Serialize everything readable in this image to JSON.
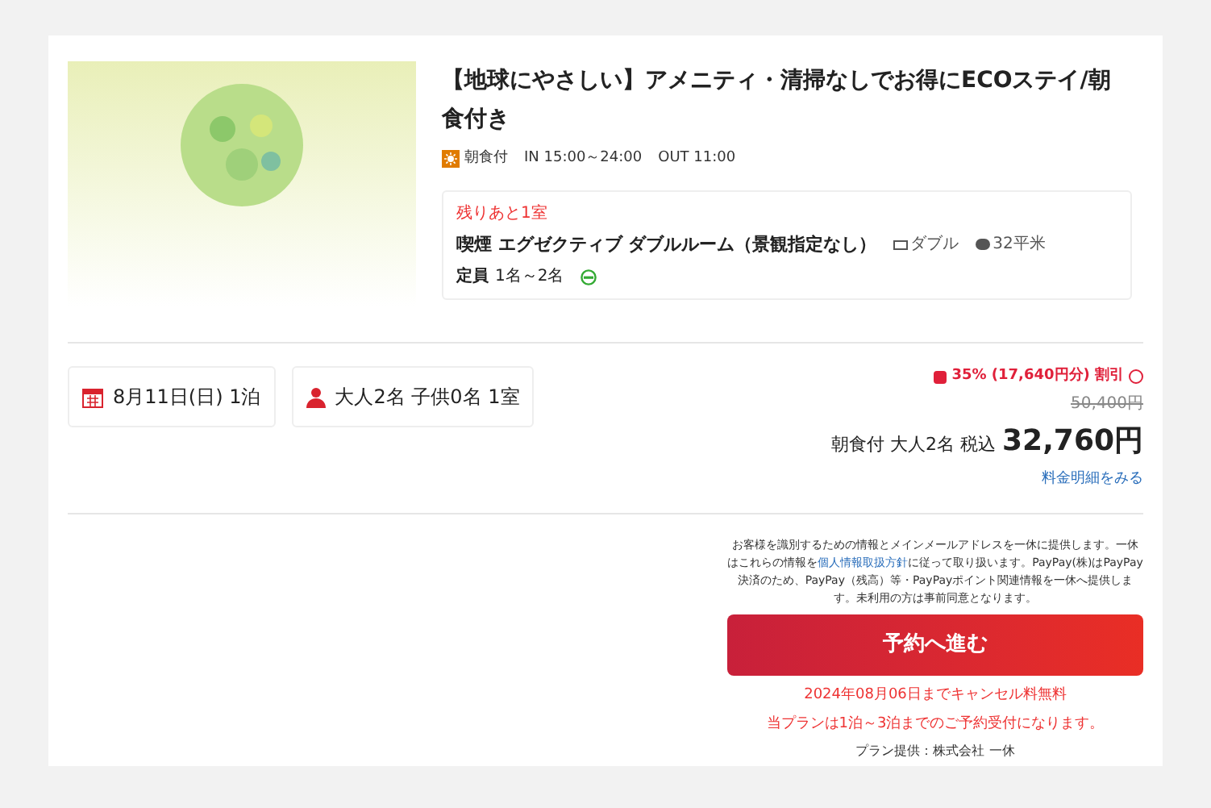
{
  "plan": {
    "title": "【地球にやさしい】アメニティ・清掃なしでお得にECOステイ/朝食付き",
    "meal": "朝食付",
    "checkin": "IN 15:00～24:00",
    "checkout": "OUT 11:00"
  },
  "room": {
    "remaining": "残りあと1室",
    "name": "喫煙 エグゼクティブ ダブルルーム（景観指定なし）",
    "bed": "ダブル",
    "size": "32平米",
    "capacity_label": "定員",
    "capacity": "1名～2名",
    "smoking": true
  },
  "conditions": [
    {
      "kind": "date",
      "text": "8月11日(日) 1泊"
    },
    {
      "kind": "guests",
      "text": "大人2名 子供0名 1室"
    }
  ],
  "price": {
    "discount": "35% (17,640円分) 割引",
    "original": "50,400円",
    "summary": "朝食付 大人2名 税込",
    "total": "32,760円",
    "details_link": "料金明細をみる"
  },
  "notice": {
    "before": "お客様を識別するための情報とメインメールアドレスを一休に提供します。一休はこれらの情報を",
    "link": "個人情報取扱方針",
    "after": "に従って取り扱います。PayPay(株)はPayPay決済のため、PayPay（残高）等・PayPayポイント関連情報を一休へ提供します。未利用の方は事前同意となります。"
  },
  "reserve_button": "予約へ進む",
  "cancel_note": "2024年08月06日までキャンセル料無料",
  "stay_note": "当プランは1泊～3泊までのご予約受付になります。",
  "provider": "プラン提供：株式会社 一休"
}
